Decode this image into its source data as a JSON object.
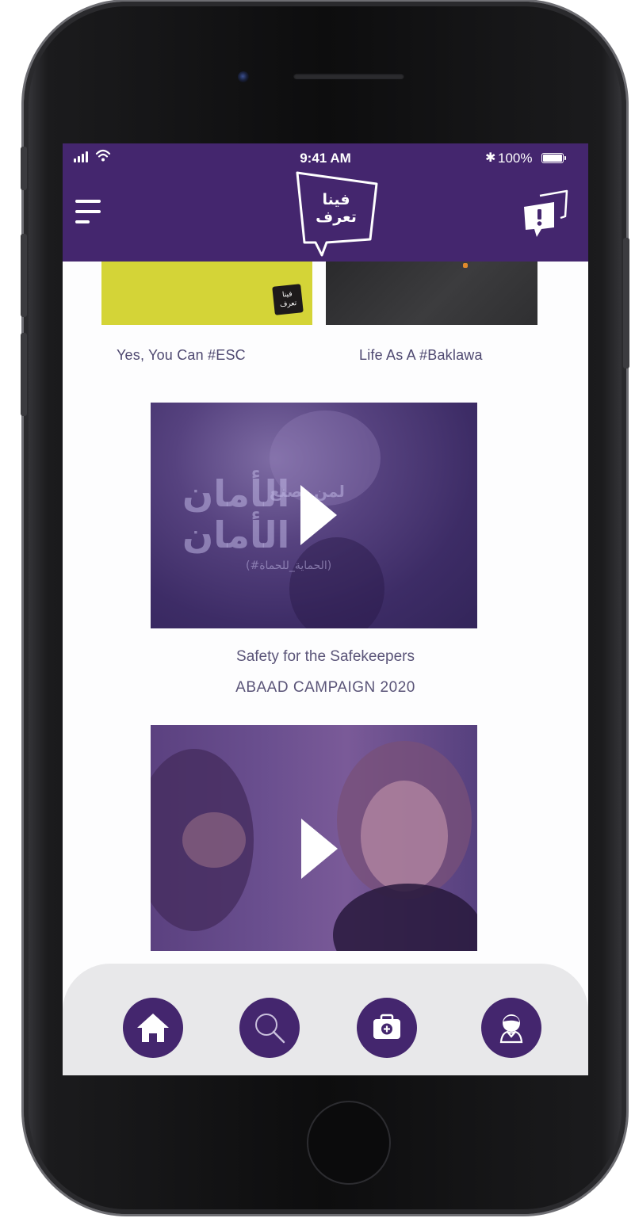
{
  "status_bar": {
    "time": "9:41 AM",
    "battery": "100%",
    "bluetooth_glyph": "✱"
  },
  "header": {
    "logo_text": "فينا تعرف",
    "menu_icon": "hamburger-menu-icon",
    "report_icon": "report-speech-bubble-icon"
  },
  "content": {
    "thumbnails": [
      {
        "caption": "Yes, You Can #ESC",
        "mini_logo": "فينا تعرف",
        "color": "#d4d437"
      },
      {
        "caption": "Life As A #Baklawa",
        "color": "#2f2f31"
      }
    ],
    "videos": [
      {
        "title": "Safety for the Safekeepers",
        "subtitle": "ABAAD CAMPAIGN 2020",
        "overlay_line1": "الأمان",
        "overlay_line2": "لمن يصنع",
        "overlay_line3": "الأمان",
        "overlay_hashtag": "(#الحماية_للحماة)"
      },
      {
        "title": "",
        "subtitle": ""
      }
    ]
  },
  "bottom_nav": {
    "items": [
      {
        "icon": "home-icon"
      },
      {
        "icon": "search-icon"
      },
      {
        "icon": "first-aid-kit-icon"
      },
      {
        "icon": "profile-icon"
      }
    ]
  },
  "colors": {
    "brand_purple": "#44266e",
    "nav_background": "#e8e8ea",
    "caption_text": "#5a5478"
  }
}
